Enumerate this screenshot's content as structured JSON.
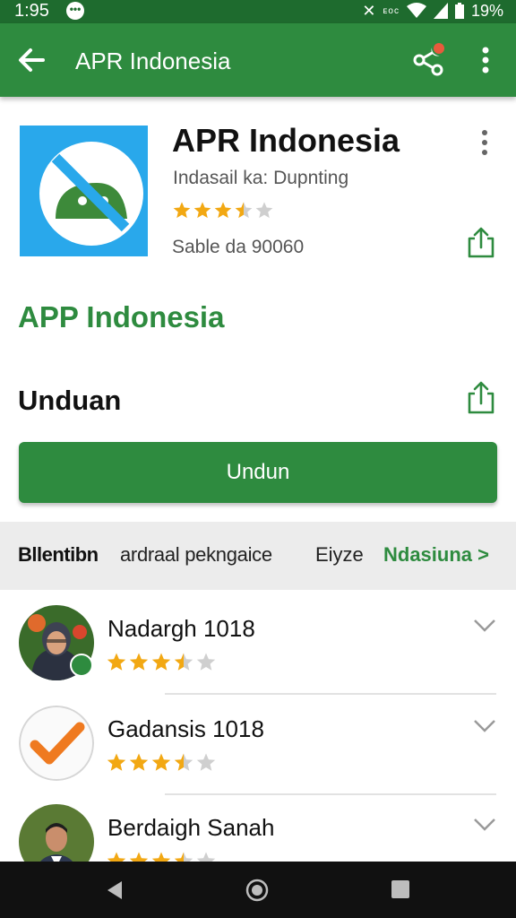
{
  "status_bar": {
    "time": "1:95",
    "message_icon": "chat-bubble-icon",
    "signal_text": "ᴇᴏᴄ",
    "battery": "19%"
  },
  "app_bar": {
    "title": "APR Indonesia",
    "back_icon": "arrow-back-icon",
    "share_icon": "share-icon",
    "more_icon": "more-vert-icon"
  },
  "app": {
    "name": "APR Indonesia",
    "developer": "Indasail ka: Dupnting",
    "rating": 3.5,
    "sales": "Sable da 90060",
    "icon_color": "#29a8eb"
  },
  "section": {
    "title": "APP Indonesia",
    "download_label": "Unduan",
    "button_label": "Undun"
  },
  "tabs": [
    {
      "label": "Bllentibn"
    },
    {
      "label": "ardraal pekngaice"
    },
    {
      "label": "Eiyze"
    },
    {
      "label": "Ndasiuna >"
    }
  ],
  "reviews": [
    {
      "name": "Nadargh 1018",
      "rating": 3.5
    },
    {
      "name": "Gadansis 1018",
      "rating": 3.5
    },
    {
      "name": "Berdaigh Sanah",
      "rating": 3.5
    }
  ],
  "colors": {
    "primary": "#2e8b3f",
    "status_bar": "#1e6b2e",
    "star": "#f2a813"
  }
}
